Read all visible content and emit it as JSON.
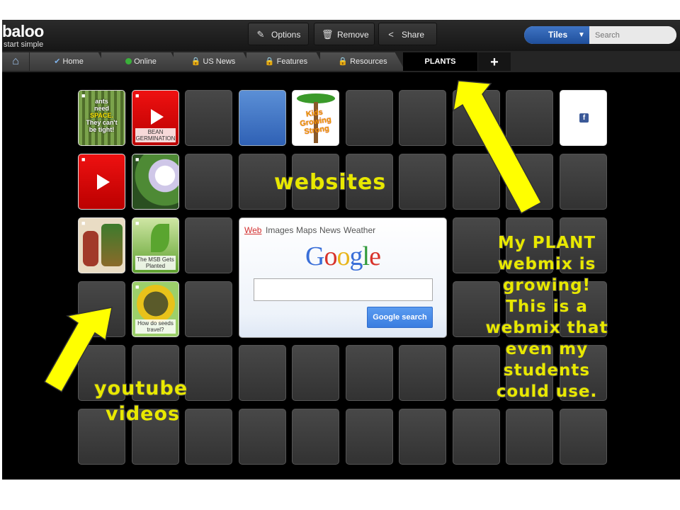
{
  "app": {
    "logo": "baloo",
    "tagline": "start simple"
  },
  "toolbar": {
    "options_label": "Options",
    "remove_label": "Remove",
    "share_label": "Share"
  },
  "view_select": {
    "label": "Tiles",
    "caret": "▼"
  },
  "search": {
    "placeholder": "Search"
  },
  "tabs": [
    {
      "label": "Home",
      "icon": "check-icon"
    },
    {
      "label": "Online",
      "icon": "green-dot-icon",
      "color": "#3ab03a"
    },
    {
      "label": "US News",
      "icon": "lock-icon"
    },
    {
      "label": "Features",
      "icon": "lock-icon"
    },
    {
      "label": "Resources",
      "icon": "lock-icon"
    },
    {
      "label": "PLANTS",
      "active": true
    }
  ],
  "add_tab": "+",
  "tiles": {
    "plants_space": {
      "line1": "ants",
      "line2": "need",
      "line3": "SPACE.",
      "line4": "They can't",
      "line5": "be tight!"
    },
    "bean": {
      "label": "BEAN GERMINATION"
    },
    "kids": {
      "text": "Kids Growing Strong"
    },
    "facebook": {
      "text": "f"
    },
    "msb": {
      "label": "The MSB Gets Planted"
    },
    "seeds": {
      "label": "How do seeds travel?"
    }
  },
  "google_widget": {
    "nav": [
      "Web",
      "Images",
      "Maps",
      "News",
      "Weather"
    ],
    "logo": "Google",
    "button": "Google search"
  },
  "annotations": {
    "websites": "websites",
    "youtube": [
      "youtube",
      "videos"
    ],
    "plant_note": [
      "My PLANT",
      "webmix is",
      "growing!",
      "This is a",
      "webmix that",
      "even my",
      "students",
      "could use."
    ]
  },
  "colors": {
    "annotation": "#e8e800",
    "arrow": "#ffff00",
    "accent_blue": "#2a5db0"
  }
}
